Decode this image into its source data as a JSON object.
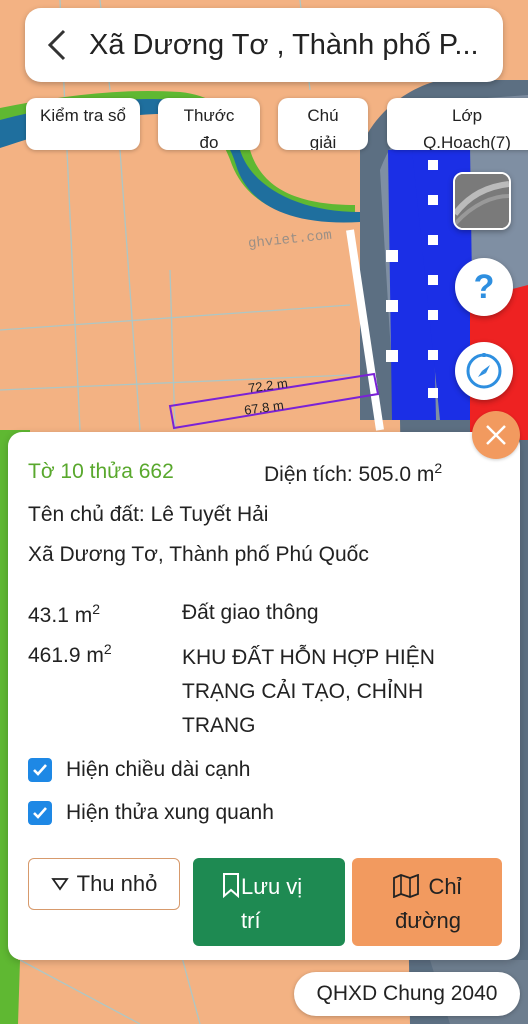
{
  "header": {
    "title": "Xã Dương Tơ , Thành phố P..."
  },
  "chips": [
    {
      "label": "Kiểm tra sổ"
    },
    {
      "label": "Thước đo"
    },
    {
      "label": "Chú giải"
    },
    {
      "label": "Lớp Q.Hoach(7)"
    }
  ],
  "map": {
    "watermark": "ghviet.com",
    "edge_top": "72.2 m",
    "edge_bottom": "67.8 m"
  },
  "info": {
    "parcel": "Tờ 10 thửa 662",
    "area_label": "Diện tích: 505.0 m",
    "area_sup": "2",
    "owner": "Tên chủ đất: Lê Tuyết Hải",
    "address": "Xã Dương Tơ, Thành phố Phú Quốc",
    "land_uses": [
      {
        "area": "43.1 m",
        "sup": "2",
        "type": "Đất giao thông"
      },
      {
        "area": "461.9 m",
        "sup": "2",
        "type": "KHU ĐẤT HỖN HỢP HIỆN TRẠNG CẢI TẠO, CHỈNH TRANG"
      }
    ],
    "checkboxes": [
      {
        "label": "Hiện chiều dài cạnh",
        "checked": true
      },
      {
        "label": "Hiện thửa xung quanh",
        "checked": true
      }
    ]
  },
  "actions": {
    "collapse": "Thu nhỏ",
    "save": "Lưu vị trí",
    "directions": "Chỉ đường"
  },
  "footer": {
    "plan_label": "QHXD Chung 2040"
  },
  "colors": {
    "map_bg": "#f3b283",
    "river": "#1f6f9e",
    "green": "#59a82d",
    "save": "#1e8a52",
    "directions": "#f29a5f",
    "checkbox": "#1e88e5"
  }
}
